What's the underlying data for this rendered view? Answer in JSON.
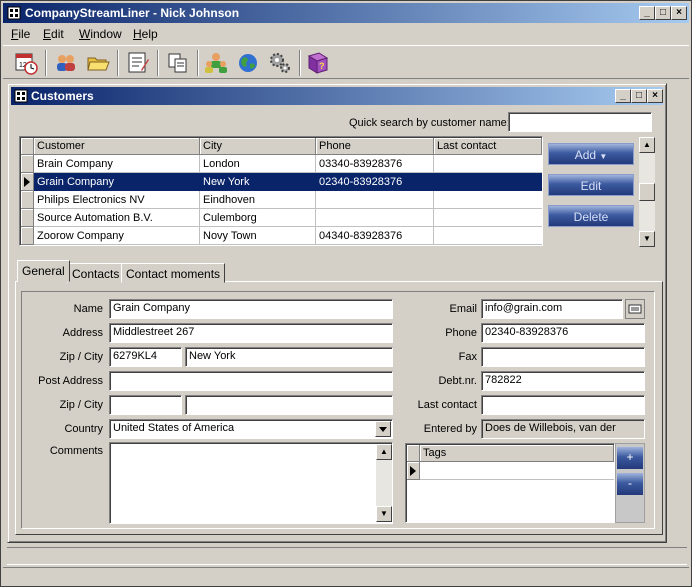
{
  "app": {
    "title": "CompanyStreamLiner - Nick Johnson",
    "window_controls": {
      "minimize": "_",
      "maximize": "□",
      "close": "×"
    }
  },
  "menu": [
    {
      "label": "File",
      "accel": "F",
      "rest": "ile"
    },
    {
      "label": "Edit",
      "accel": "E",
      "rest": "dit"
    },
    {
      "label": "Window",
      "accel": "W",
      "rest": "indow"
    },
    {
      "label": "Help",
      "accel": "H",
      "rest": "elp"
    }
  ],
  "toolbar": {
    "icons": [
      "calendar-clock-icon",
      "contacts-icon",
      "open-folder-icon",
      "notes-icon",
      "copy-documents-icon",
      "users-icon",
      "globe-icon",
      "gears-icon",
      "help-book-icon"
    ]
  },
  "customers": {
    "title": "Customers",
    "search_label": "Quick search by customer name:",
    "search_value": "",
    "columns": [
      "Customer",
      "City",
      "Phone",
      "Last contact"
    ],
    "rows": [
      {
        "customer": "Brain Company",
        "city": "London",
        "phone": "03340-83928376",
        "last": ""
      },
      {
        "customer": "Grain Company",
        "city": "New York",
        "phone": "02340-83928376",
        "last": ""
      },
      {
        "customer": "Philips Electronics NV",
        "city": "Eindhoven",
        "phone": "",
        "last": ""
      },
      {
        "customer": "Source Automation B.V.",
        "city": "Culemborg",
        "phone": "",
        "last": ""
      },
      {
        "customer": "Zoorow Company",
        "city": "Novy Town",
        "phone": "04340-83928376",
        "last": ""
      }
    ],
    "selected_row": 1,
    "buttons": {
      "add": "Add",
      "edit": "Edit",
      "delete": "Delete"
    }
  },
  "tabs": [
    "General",
    "Contacts",
    "Contact moments"
  ],
  "general": {
    "labels": {
      "name": "Name",
      "address": "Address",
      "zip_city": "Zip / City",
      "post_address": "Post Address",
      "zip_city2": "Zip / City",
      "country": "Country",
      "comments": "Comments",
      "email": "Email",
      "phone": "Phone",
      "fax": "Fax",
      "debt": "Debt.nr.",
      "last_contact": "Last contact",
      "entered_by": "Entered by"
    },
    "values": {
      "name": "Grain Company",
      "address": "Middlestreet 267",
      "zip": "6279KL4",
      "city": "New York",
      "post_address": "",
      "zip2": "",
      "city2": "",
      "country": "United States of America",
      "comments": "",
      "email": "info@grain.com",
      "phone": "02340-83928376",
      "fax": "",
      "debt": "782822",
      "last_contact": "",
      "entered_by": "Does de Willebois, van der"
    },
    "tags": {
      "header": "Tags",
      "add": "+",
      "remove": "-"
    }
  }
}
